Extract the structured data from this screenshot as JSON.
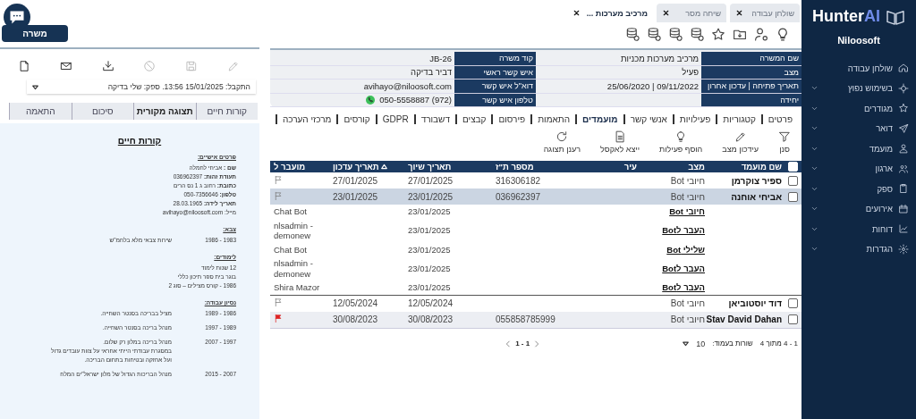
{
  "sidebar": {
    "logo_main": "Hunter",
    "logo_accent": "AI",
    "company": "Niloosoft",
    "items": [
      {
        "label": "שולחן עבודה",
        "expandable": false
      },
      {
        "label": "בשימוש נפוץ",
        "expandable": true
      },
      {
        "label": "מגודרים",
        "expandable": true
      },
      {
        "label": "דואר",
        "expandable": true
      },
      {
        "label": "מועמד",
        "expandable": true
      },
      {
        "label": "ארגון",
        "expandable": true
      },
      {
        "label": "ספק",
        "expandable": true
      },
      {
        "label": "אירועים",
        "expandable": true
      },
      {
        "label": "דוחות",
        "expandable": true
      },
      {
        "label": "הגדרות",
        "expandable": true
      }
    ]
  },
  "tabs": [
    {
      "label": "שולחן עבודה",
      "selected": false
    },
    {
      "label": "שיחה מסר",
      "selected": false
    },
    {
      "label": "מרכיב מערכות ...",
      "selected": true
    }
  ],
  "job_button": "משרה",
  "info": [
    {
      "label": "שם המשרה",
      "value": "מרכיב מערכות מכניות",
      "label2": "קוד משרה",
      "value2": "JB-26"
    },
    {
      "label": "מצב",
      "value": "פעיל",
      "label2": "איש קשר ראשי",
      "value2": "דביר בדיקה"
    },
    {
      "label": "תאריך פתיחה | עדכון אחרון",
      "value": "09/11/2022 | 25/06/2020",
      "label2": "דוא\"ל איש קשר",
      "value2": "avihayo@niloosoft.com"
    },
    {
      "label": "יחידה",
      "label2": "טלפון איש קשר",
      "value2": "(972) 050-5558887",
      "whatsapp": true
    }
  ],
  "subtabs": [
    {
      "label": "פרטים",
      "selected": false
    },
    {
      "label": "קטגוריות",
      "selected": false
    },
    {
      "label": "פעילויות",
      "selected": false
    },
    {
      "label": "אנשי קשר",
      "selected": false
    },
    {
      "label": "מועמדים",
      "selected": true
    },
    {
      "label": "התאמות",
      "selected": false
    },
    {
      "label": "פירסום",
      "selected": false
    },
    {
      "label": "קבצים",
      "selected": false
    },
    {
      "label": "דשבורד",
      "selected": false
    },
    {
      "label": "GDPR",
      "selected": false
    },
    {
      "label": "קורסים",
      "selected": false
    },
    {
      "label": "מרכזי הערכה",
      "selected": false
    }
  ],
  "actions": [
    "סנן",
    "עידכון מצב",
    "הוסף פעילות",
    "ייצא לאקסל",
    "רענן תצוגה"
  ],
  "table": {
    "all_checked": false,
    "columns": [
      {
        "label": "שם מועמד",
        "sorted": false
      },
      {
        "label": "מצב",
        "sorted": false
      },
      {
        "label": "עיר",
        "sorted": false
      },
      {
        "label": "מספר ת\"ז",
        "sorted": false
      },
      {
        "label": "תאריך שיוך",
        "sorted": false
      },
      {
        "label": "תאריך עדכון",
        "sorted": true
      },
      {
        "label": "מועבר ל",
        "sorted": false
      }
    ],
    "rows": [
      {
        "kind": "candidate",
        "name": "ספיר צוקרמן",
        "status": "חיובי Bot",
        "id": "316306182",
        "assigned": "27/01/2025",
        "updated": "27/01/2025",
        "checked": false,
        "selected": false,
        "flagged": false
      },
      {
        "kind": "candidate",
        "name": "אביחי אוחנה",
        "status": "חיובי Bot",
        "id": "036962397",
        "assigned": "23/01/2025",
        "updated": "23/01/2025",
        "checked": false,
        "selected": true,
        "flagged": false
      },
      {
        "kind": "history",
        "status": "חיובי Bot",
        "assigned": "23/01/2025",
        "to": "Chat Bot"
      },
      {
        "kind": "history",
        "status": "העבר לBot",
        "assigned": "23/01/2025",
        "to": "nlsadmin - demonew"
      },
      {
        "kind": "history",
        "status": "שלילי Bot",
        "assigned": "23/01/2025",
        "to": "Chat Bot"
      },
      {
        "kind": "history",
        "status": "העבר לBot",
        "assigned": "23/01/2025",
        "to": "nlsadmin - demonew"
      },
      {
        "kind": "history",
        "status": "העבר לBot",
        "assigned": "23/01/2025",
        "to": "Shira Mazor"
      },
      {
        "kind": "candidate",
        "name": "דוד יוסטוביאן",
        "status": "חיובי Bot",
        "assigned": "12/05/2024",
        "updated": "12/05/2024",
        "checked": false,
        "selected": false,
        "flagged": false
      },
      {
        "kind": "candidate",
        "name": "Stav David Dahan",
        "status": "חיובי Bot",
        "id": "055858785999",
        "assigned": "30/08/2023",
        "updated": "30/08/2023",
        "checked": false,
        "selected": false,
        "flagged": true
      }
    ]
  },
  "pagination": {
    "pages": "1 - 1",
    "range": "1 - 4 מתוך 4",
    "rows_label": "שורות בעמוד:",
    "rows_value": "10"
  },
  "document_actions": [
    {
      "disabled": true
    },
    {
      "disabled": true
    },
    {
      "disabled": true
    },
    {
      "disabled": false
    },
    {
      "disabled": false
    },
    {
      "disabled": false
    }
  ],
  "document_select": "התקבל: 15/01/2025 13:56. ספק: שלי בדיקה",
  "document_tabs": [
    {
      "label": "קורות חיים",
      "selected": false
    },
    {
      "label": "תצוגה מקורית",
      "selected": true
    },
    {
      "label": "סיכום",
      "selected": false
    },
    {
      "label": "התאמה",
      "selected": false
    }
  ],
  "cv": {
    "title": "קורות חיים",
    "sections": [
      {
        "heading": "פרטים אישיים:",
        "items": [
          {
            "kind": "field",
            "label": "שם :",
            "text": "אביחי לחמלה"
          },
          {
            "kind": "field",
            "label": "תעודת זהות:",
            "text": "036962397"
          },
          {
            "kind": "field",
            "label": "כתובת:",
            "text": "רחוב ג 1 נס הרים"
          },
          {
            "kind": "field",
            "label": "טלפון:",
            "text": "050-7356646"
          },
          {
            "kind": "field",
            "label": "תאריך לידה:",
            "text": "28.03.1965"
          },
          {
            "kind": "line",
            "text": "מייל: avihayo@niloosoft.com"
          }
        ]
      },
      {
        "heading": "צבא:",
        "items": [
          {
            "kind": "entry",
            "years": "1983 - 1986",
            "lines": [
              "שירות צבאי מלא בלחמ\"ש"
            ]
          }
        ]
      },
      {
        "heading": "לימודים:",
        "items": [
          {
            "kind": "line",
            "text": "12 שנות לימוד"
          },
          {
            "kind": "line",
            "text": "בוגר בית ספר תיכון כללי"
          },
          {
            "kind": "line",
            "text": "1986 - קורס מצילים – סוג 2"
          }
        ]
      },
      {
        "heading": "נסיון עבודה:",
        "items": [
          {
            "kind": "entry",
            "years": "1986 - 1989",
            "lines": [
              "מציל בבריכה בסנטר השחייה."
            ]
          },
          {
            "kind": "entry",
            "years": "1989 - 1997",
            "lines": [
              "מנהל בריכה בסנטר השחייה."
            ]
          },
          {
            "kind": "entry",
            "years": "1997 - 2007",
            "lines": [
              "מנהל בריכה במלון רק שלום.",
              "במסגרת עבודתי הייתי אחראי על צוות עובדים גדול",
              "ועל אחזקה ובטיחות בתחום הבריכה."
            ]
          },
          {
            "kind": "entry",
            "years": "2007 - 2015",
            "lines": [
              "מנהל הבריכות הגדול של מלון ישראל\"ים המלח"
            ]
          }
        ]
      }
    ]
  }
}
